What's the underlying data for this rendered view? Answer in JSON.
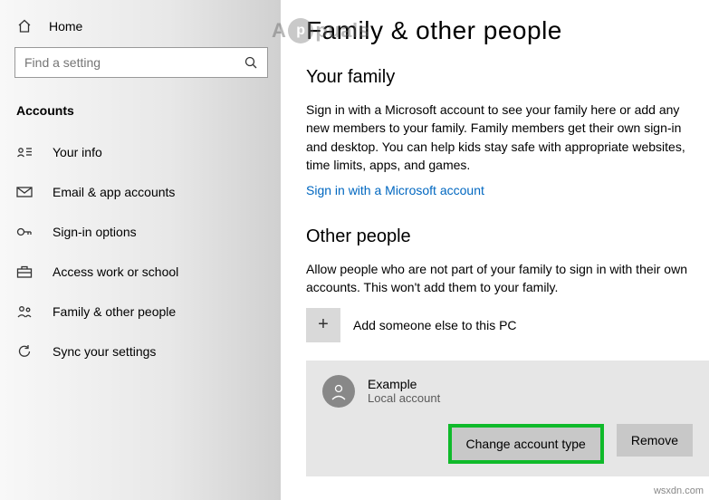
{
  "sidebar": {
    "home_label": "Home",
    "search_placeholder": "Find a setting",
    "category": "Accounts",
    "items": [
      {
        "label": "Your info"
      },
      {
        "label": "Email & app accounts"
      },
      {
        "label": "Sign-in options"
      },
      {
        "label": "Access work or school"
      },
      {
        "label": "Family & other people"
      },
      {
        "label": "Sync your settings"
      }
    ]
  },
  "main": {
    "title": "Family & other people",
    "family": {
      "heading": "Your family",
      "body": "Sign in with a Microsoft account to see your family here or add any new members to your family. Family members get their own sign-in and desktop. You can help kids stay safe with appropriate websites, time limits, apps, and games.",
      "link": "Sign in with a Microsoft account"
    },
    "other": {
      "heading": "Other people",
      "body": "Allow people who are not part of your family to sign in with their own accounts. This won't add them to your family.",
      "add_label": "Add someone else to this PC",
      "account": {
        "name": "Example",
        "type": "Local account",
        "change_label": "Change account type",
        "remove_label": "Remove"
      }
    }
  },
  "watermark_site": "wsxdn.com",
  "watermark_brand_prefix": "A",
  "watermark_brand_suffix": "puals"
}
